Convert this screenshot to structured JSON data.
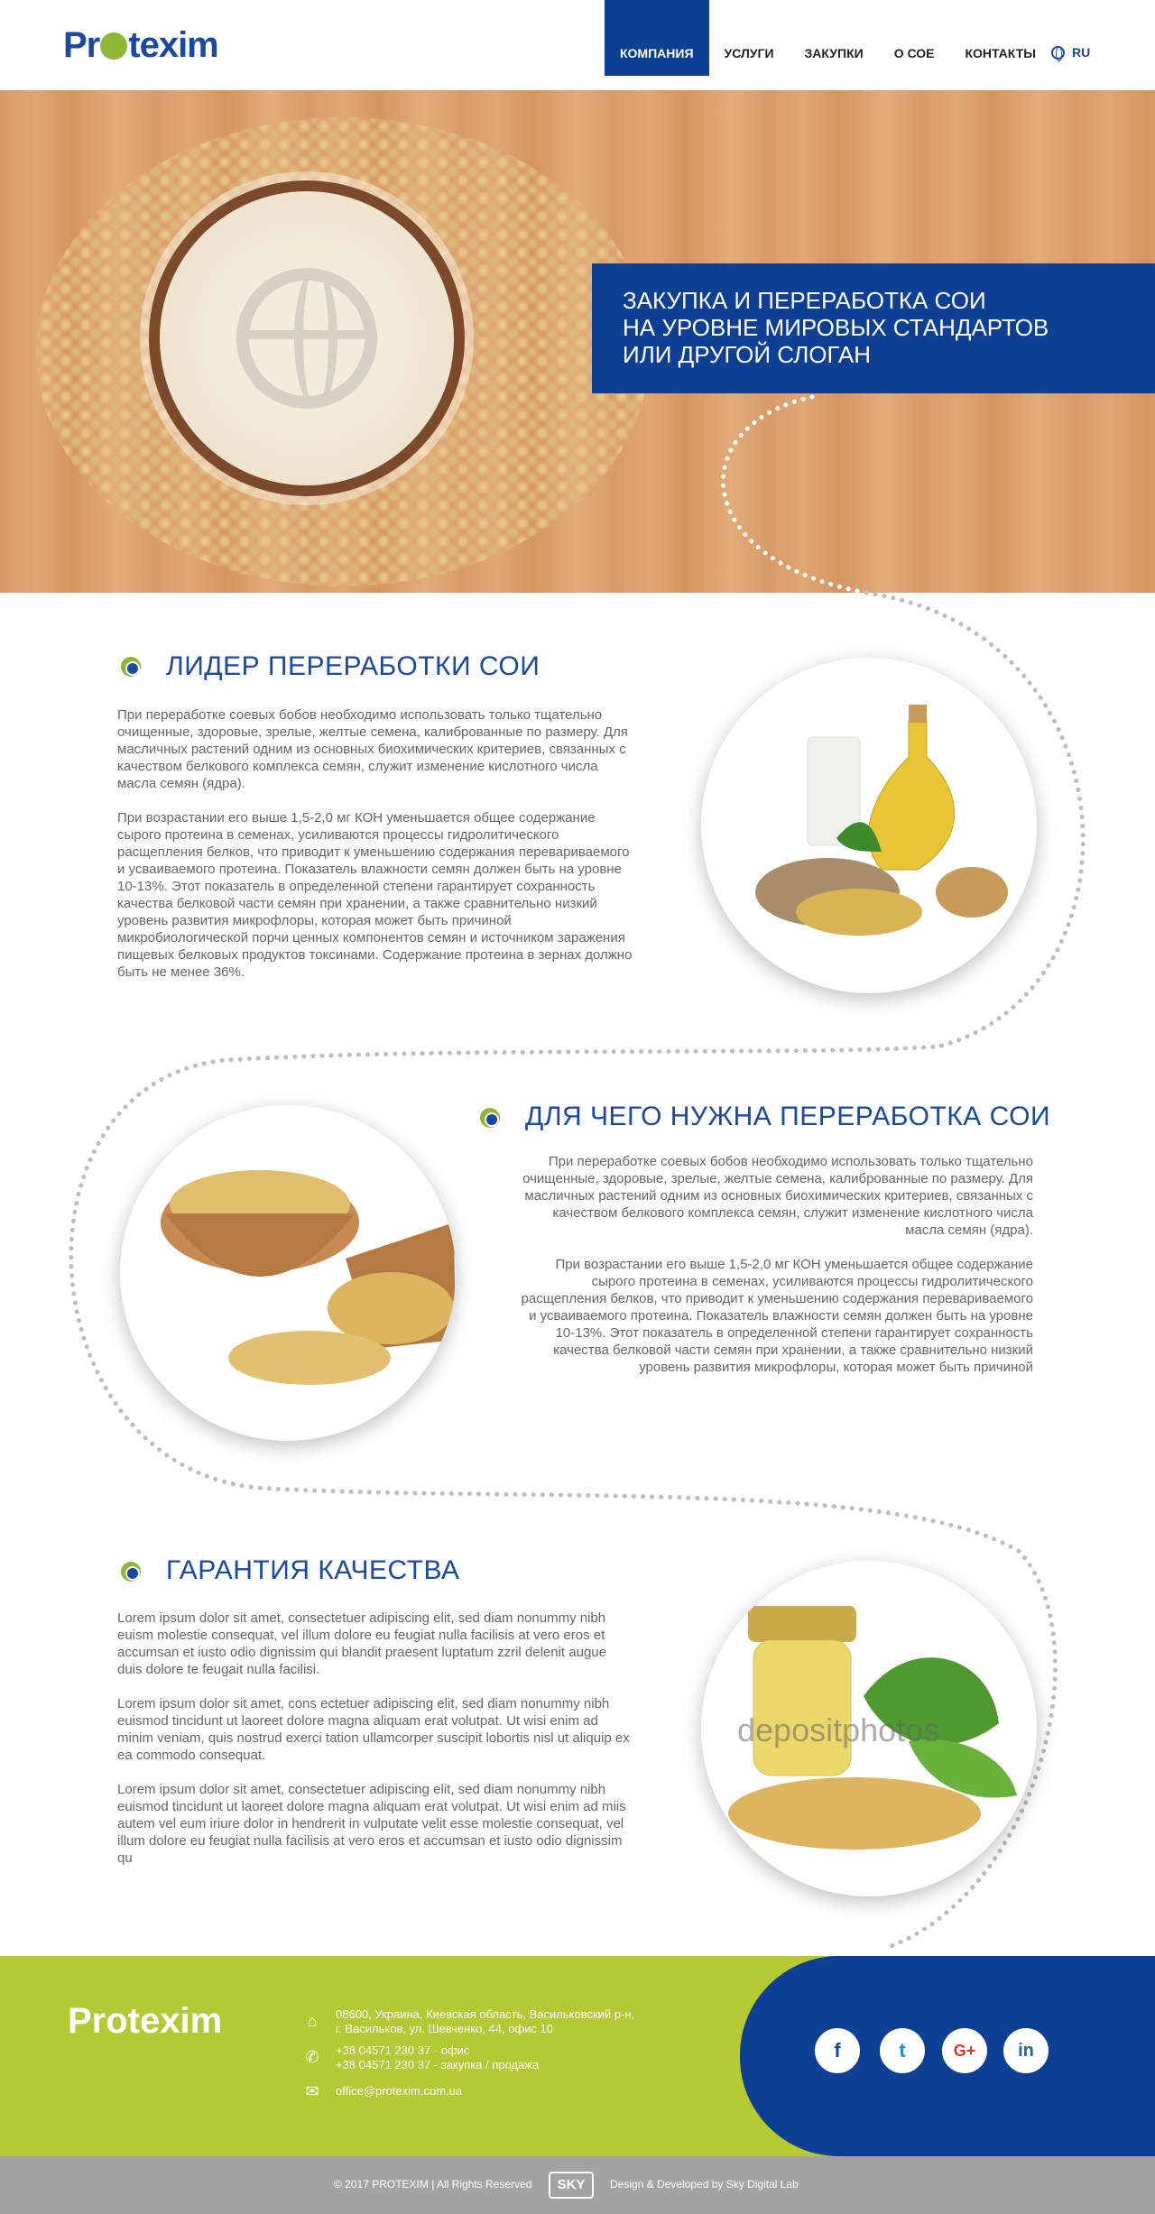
{
  "header": {
    "logo": "Protexim",
    "nav": [
      "КОМПАНИЯ",
      "УСЛУГИ",
      "ЗАКУПКИ",
      "О СОЕ",
      "КОНТАКТЫ"
    ],
    "lang": "RU"
  },
  "hero": {
    "slogan": [
      "ЗАКУПКА И ПЕРЕРАБОТКА СОИ",
      "НА УРОВНЕ МИРОВЫХ СТАНДАРТОВ",
      "ИЛИ ДРУГОЙ СЛОГАН"
    ]
  },
  "section1": {
    "title": "ЛИДЕР ПЕРЕРАБОТКИ СОИ",
    "p1": "При переработке соевых бобов необходимо использовать только тщательно очищенные, здоровые, зрелые, желтые семена, калиброванные по размеру. Для масличных растений одним из основных биохимических критериев, связанных с качеством белкового комплекса семян, служит изменение кислотного числа масла семян (ядра).",
    "p2": "При возрастании его выше 1,5-2,0 мг КОН уменьшается общее содержание сырого протеина в семенах, усиливаются процессы гидролитического расщепления белков, что приводит к уменьшению содержания перевариваемого и усваиваемого протеина. Показатель влажности семян должен быть на уровне 10-13%. Этот показатель в определенной степени гарантирует сохранность качества белковой части семян при хранении, а также сравнительно низкий уровень развития микрофлоры, которая может быть причиной микробиологической порчи ценных компонентов семян и источником заражения пищевых белковых продуктов токсинами. Содержание протеина в зернах должно быть не менее 36%."
  },
  "section2": {
    "title": "ДЛЯ ЧЕГО НУЖНА ПЕРЕРАБОТКА СОИ",
    "p1": "При переработке соевых бобов необходимо использовать только тщательно очищенные, здоровые, зрелые, желтые семена, калиброванные по размеру. Для масличных растений одним из основных биохимических критериев, связанных с качеством белкового комплекса семян, служит изменение кислотного числа масла семян (ядра).",
    "p2": "При возрастании его выше 1,5-2,0 мг КОН уменьшается общее содержание сырого протеина в семенах, усиливаются процессы гидролитического расщепления белков, что приводит к уменьшению содержания перевариваемого и усваиваемого протеина. Показатель влажности семян должен быть на уровне 10-13%. Этот показатель в определенной степени гарантирует сохранность качества белковой части семян при хранении, а также сравнительно низкий уровень развития микрофлоры, которая может быть причиной"
  },
  "section3": {
    "title": "ГАРАНТИЯ КАЧЕСТВА",
    "p1": "Lorem ipsum dolor sit amet, consectetuer adipiscing elit, sed diam nonummy nibh euism molestie consequat, vel illum dolore eu feugiat nulla facilisis at vero eros et accumsan et iusto odio dignissim qui blandit praesent luptatum zzril delenit augue duis dolore te feugait nulla facilisi.",
    "p2": "Lorem ipsum dolor sit amet, cons ectetuer adipiscing elit, sed diam nonummy nibh euismod tincidunt ut laoreet dolore magna aliquam erat volutpat. Ut wisi enim ad minim veniam, quis nostrud exerci tation ullamcorper suscipit lobortis nisl ut aliquip ex ea commodo consequat.",
    "p3": "Lorem ipsum dolor sit amet, consectetuer adipiscing elit, sed diam nonummy nibh euismod tincidunt ut laoreet dolore magna aliquam erat volutpat. Ut wisi enim ad miis autem vel eum iriure dolor in hendrerit in vulputate velit esse molestie consequat, vel illum dolore eu feugiat nulla facilisis at vero eros et accumsan et iusto odio dignissim qu",
    "watermark": "depositphotos"
  },
  "footer": {
    "logo": "Protexim",
    "address": [
      "08600, Украина, Киевская область, Васильковский р-н,",
      "г. Васильков, ул. Шевченко, 44, офис 10"
    ],
    "phones": [
      "+38 04571 230 37 - офис",
      "+38 04571 230 37 - закупка / продажа"
    ],
    "email": "office@protexim.com.ua",
    "social": [
      "f",
      "t",
      "G+",
      "in"
    ]
  },
  "bottom": {
    "copyright": "© 2017 PROTEXIM  |  All Rights Reserved",
    "sky": "SKY",
    "dev": "Design & Developed by Sky Digital Lab"
  }
}
